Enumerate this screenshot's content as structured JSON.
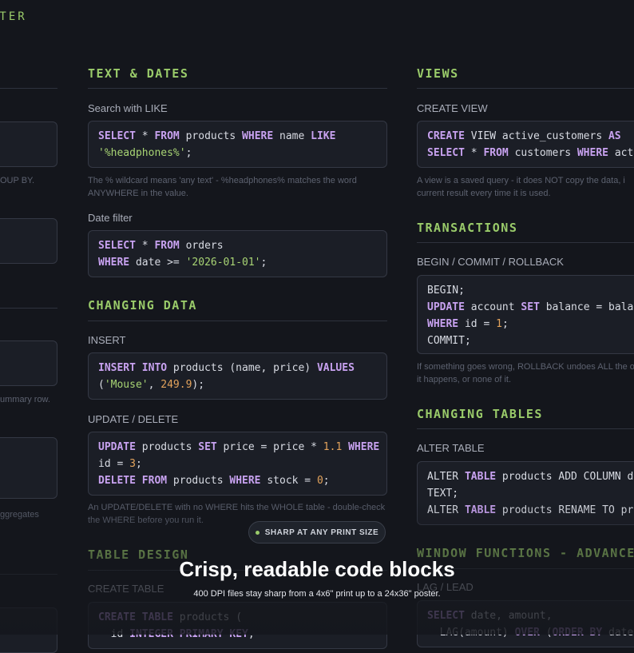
{
  "header": {
    "title_fragment": "STER"
  },
  "left_column": {
    "note1": "OUP BY.",
    "note2": "ummary row.",
    "note3": "ggregates"
  },
  "middle_column": {
    "text_dates": {
      "heading": "TEXT & DATES",
      "like_label": "Search with LIKE",
      "like_code": [
        "SELECT * FROM products WHERE name LIKE",
        "'%headphones%';"
      ],
      "like_note": "The % wildcard means 'any text' - %headphones% matches the word ANYWHERE in the value.",
      "date_label": "Date filter",
      "date_code": [
        "SELECT * FROM orders",
        "WHERE date >= '2026-01-01';"
      ]
    },
    "changing_data": {
      "heading": "CHANGING DATA",
      "insert_label": "INSERT",
      "insert_code": [
        "INSERT INTO products (name, price) VALUES",
        "('Mouse', 249.9);"
      ],
      "update_label": "UPDATE / DELETE",
      "update_code": [
        "UPDATE products SET price = price * 1.1 WHERE",
        "id = 3;",
        "DELETE FROM products WHERE stock = 0;"
      ],
      "update_note": "An UPDATE/DELETE with no WHERE hits the WHOLE table - double-check the WHERE before you run it."
    },
    "table_design": {
      "heading": "TABLE DESIGN",
      "create_label": "CREATE TABLE",
      "create_code": [
        "CREATE TABLE products (",
        "  id INTEGER PRIMARY KEY,"
      ]
    }
  },
  "right_column": {
    "views": {
      "heading": "VIEWS",
      "label": "CREATE VIEW",
      "code": [
        "CREATE VIEW active_customers AS",
        "SELECT * FROM customers WHERE acti"
      ],
      "note": "A view is a saved query - it does NOT copy the data, i current result every time it is used."
    },
    "transactions": {
      "heading": "TRANSACTIONS",
      "label": "BEGIN / COMMIT / ROLLBACK",
      "code": [
        "BEGIN;",
        "UPDATE account SET balance = balan",
        "WHERE id = 1;",
        "COMMIT;"
      ],
      "note": "If something goes wrong, ROLLBACK undoes ALL the of it happens, or none of it."
    },
    "changing_tables": {
      "heading": "CHANGING TABLES",
      "label": "ALTER TABLE",
      "code": [
        "ALTER TABLE products ADD COLUMN de",
        "TEXT;",
        "ALTER TABLE products RENAME TO pro"
      ]
    },
    "window_functions": {
      "heading": "WINDOW FUNCTIONS - ADVANCED",
      "label": "LAG / LEAD",
      "code": [
        "SELECT date, amount,",
        "  LAG(amount) OVER (ORDER BY date)"
      ]
    }
  },
  "overlay": {
    "badge": "SHARP AT ANY PRINT SIZE",
    "headline": "Crisp, readable code blocks",
    "subline": "400 DPI files stay sharp from a 4x6\" print up to a 24x36\" poster."
  },
  "colors": {
    "background": "#14161c",
    "heading": "#9acb6a",
    "keyword": "#c8a2f0",
    "string": "#a8d474",
    "number": "#e3a35c"
  }
}
